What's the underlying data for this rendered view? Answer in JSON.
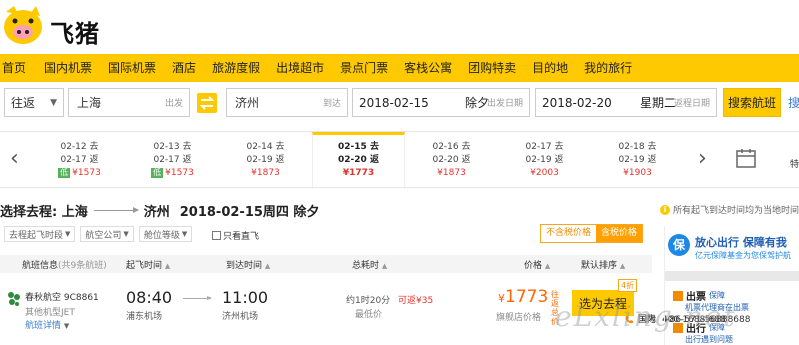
{
  "header": {
    "logo_text": "飞猪",
    "contact": [
      {
        "label": "国内",
        "number": "400-1688-688"
      },
      {
        "label": "国际",
        "number": "+86-571-56888688"
      }
    ]
  },
  "nav": {
    "items": [
      "首页",
      "国内机票",
      "国际机票",
      "酒店",
      "旅游度假",
      "出境超市",
      "景点门票",
      "客栈公寓",
      "团购特卖",
      "目的地",
      "我的旅行"
    ]
  },
  "search": {
    "trip_type": "往返",
    "from_value": "上海",
    "from_hint": "出发",
    "to_value": "济州",
    "to_hint": "到达",
    "depart_date": "2018-02-15",
    "depart_extra": "除夕",
    "depart_hint": "出发日期",
    "return_date": "2018-02-20",
    "return_extra": "星期二",
    "return_hint": "返程日期",
    "submit_label": "搜索航班",
    "more_label": "搜"
  },
  "date_strip": {
    "cells": [
      {
        "go": "02-12 去",
        "back": "02-17 返",
        "price": "¥1573",
        "low": true
      },
      {
        "go": "02-13 去",
        "back": "02-17 返",
        "price": "¥1573",
        "low": true
      },
      {
        "go": "02-14 去",
        "back": "02-19 返",
        "price": "¥1873",
        "low": false
      },
      {
        "go": "02-15 去",
        "back": "02-20 返",
        "price": "¥1773",
        "low": false,
        "active": true
      },
      {
        "go": "02-16 去",
        "back": "02-20 返",
        "price": "¥1873",
        "low": false
      },
      {
        "go": "02-17 去",
        "back": "02-19 返",
        "price": "¥2003",
        "low": false
      },
      {
        "go": "02-18 去",
        "back": "02-19 返",
        "price": "¥1903",
        "low": false
      }
    ],
    "low_label": "低",
    "calendar_label": "特"
  },
  "choose": {
    "prefix": "选择去程: 上海",
    "dest": "济州",
    "date": "2018-02-15周四 除夕"
  },
  "tz_note": "所有起飞到达时间均为当地时间",
  "filters": {
    "items": [
      "去程起飞时段",
      "航空公司",
      "舱位等级"
    ],
    "direct_label": "只看直飞",
    "tax_off": "不含税价格",
    "tax_on": "含税价格"
  },
  "table_head": {
    "info": "航班信息",
    "info_sub": "(共9条航班)",
    "depart": "起飞时间",
    "arrive": "到达时间",
    "duration": "总耗时",
    "price": "价格",
    "sort": "默认排序"
  },
  "flight": {
    "airline": "春秋航空 9C8861",
    "plane": "其他机型JET",
    "detail": "航班详情",
    "dep_time": "08:40",
    "dep_airport": "浦东机场",
    "arr_time": "11:00",
    "arr_airport": "济州机场",
    "duration": "约1时20分",
    "duration_sub": "最低价",
    "fee": "可返¥35",
    "currency": "¥",
    "price": "1773",
    "price_tag": "往返总价",
    "store": "旗舰店价格",
    "select_label": "选为去程",
    "discount": "4折"
  },
  "side": {
    "badge": "保",
    "title": "放心出行 保障有我",
    "sub": "亿元保障基金为您保驾护航",
    "items": [
      {
        "title": "出票",
        "small": "保障",
        "desc": "机票代理商在出票"
      },
      {
        "title": "出行",
        "small": "保障",
        "desc": "出行遇到问题"
      }
    ]
  },
  "watermark": "eLxling.net",
  "colors": {
    "brand": "#ffc900",
    "price": "#ff6600",
    "discount_red": "#e5322d",
    "link": "#3a7bd5"
  }
}
